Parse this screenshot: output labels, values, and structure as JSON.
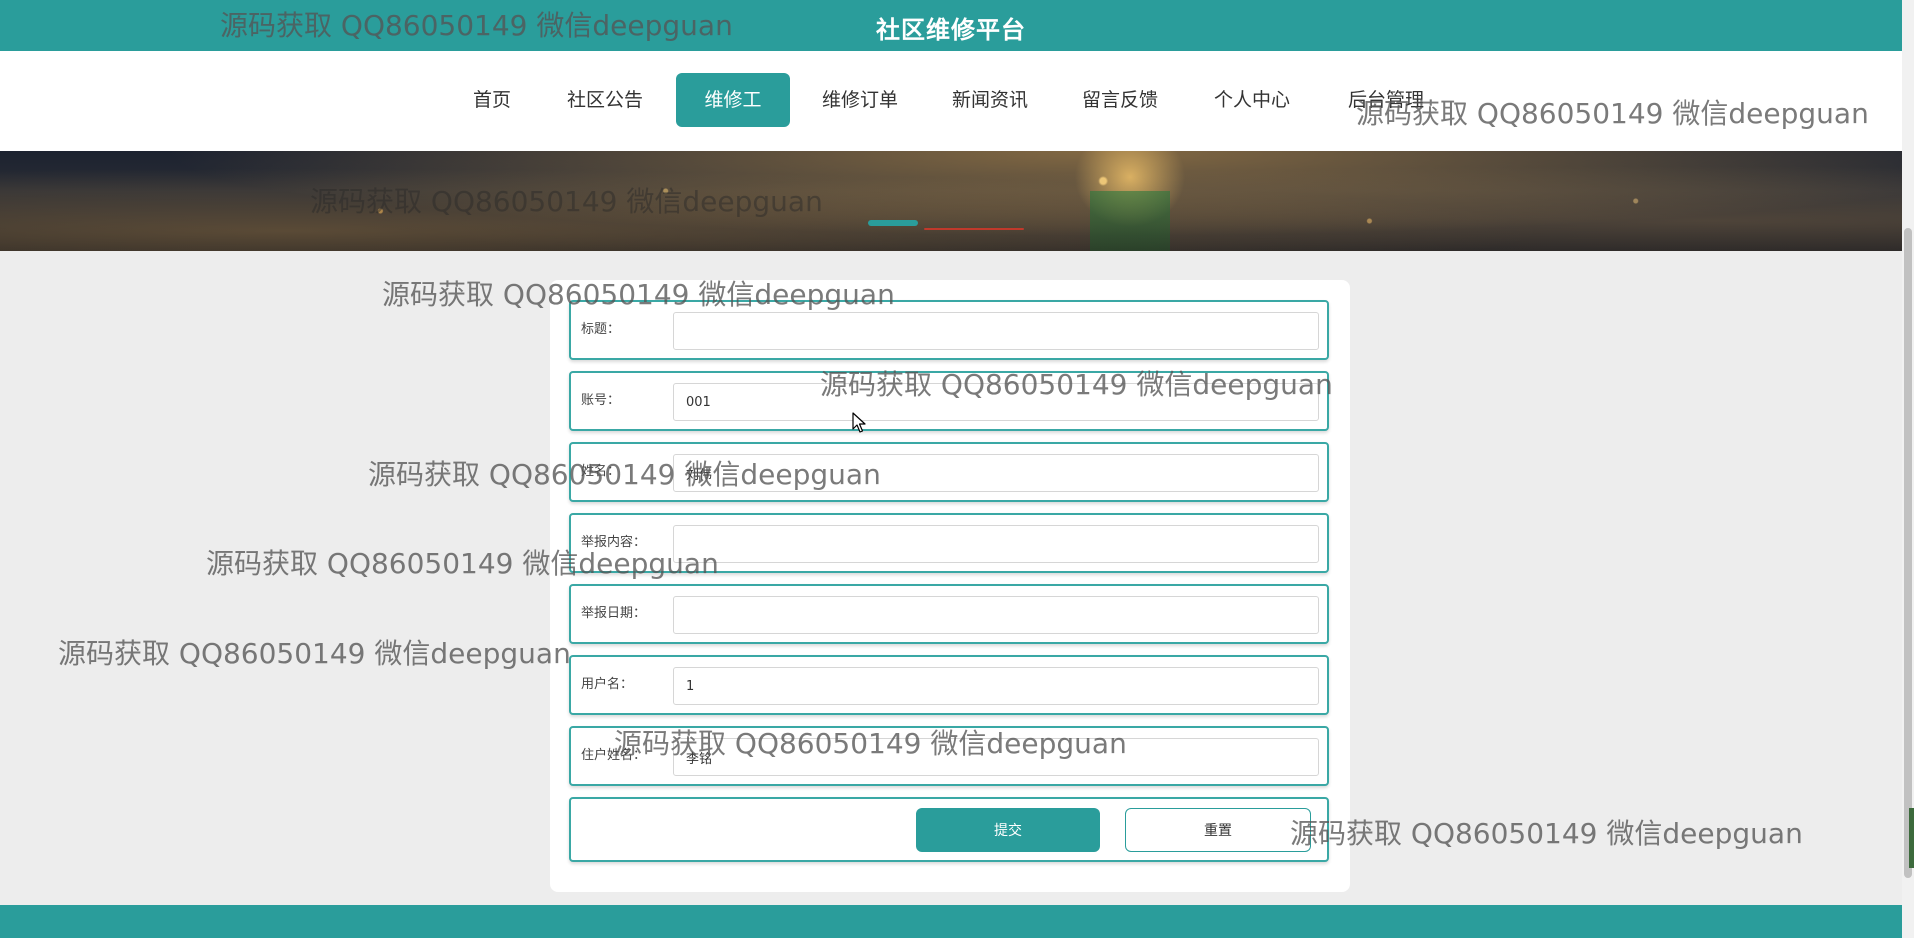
{
  "header": {
    "title": "社区维修平台"
  },
  "nav": {
    "items": [
      {
        "label": "首页"
      },
      {
        "label": "社区公告"
      },
      {
        "label": "维修工"
      },
      {
        "label": "维修订单"
      },
      {
        "label": "新闻资讯"
      },
      {
        "label": "留言反馈"
      },
      {
        "label": "个人中心"
      },
      {
        "label": "后台管理"
      }
    ],
    "active_item": "维修工"
  },
  "form": {
    "fields": [
      {
        "label": "标题：",
        "value": ""
      },
      {
        "label": "账号：",
        "value": "001"
      },
      {
        "label": "姓名：",
        "value": "刘伟"
      },
      {
        "label": "举报内容：",
        "value": ""
      },
      {
        "label": "举报日期：",
        "value": ""
      },
      {
        "label": "用户名：",
        "value": "1"
      },
      {
        "label": "住户姓名：",
        "value": "李铭"
      }
    ],
    "submit_label": "提交",
    "reset_label": "重置"
  },
  "watermark": {
    "text": "源码获取 QQ86050149 微信deepguan"
  },
  "colors": {
    "primary": "#2a9d9b",
    "background": "#ededed",
    "indicator_active": "#2a9d9b",
    "indicator_inactive": "#c0392b"
  },
  "icons": {
    "cursor": "mouse-pointer-icon"
  }
}
